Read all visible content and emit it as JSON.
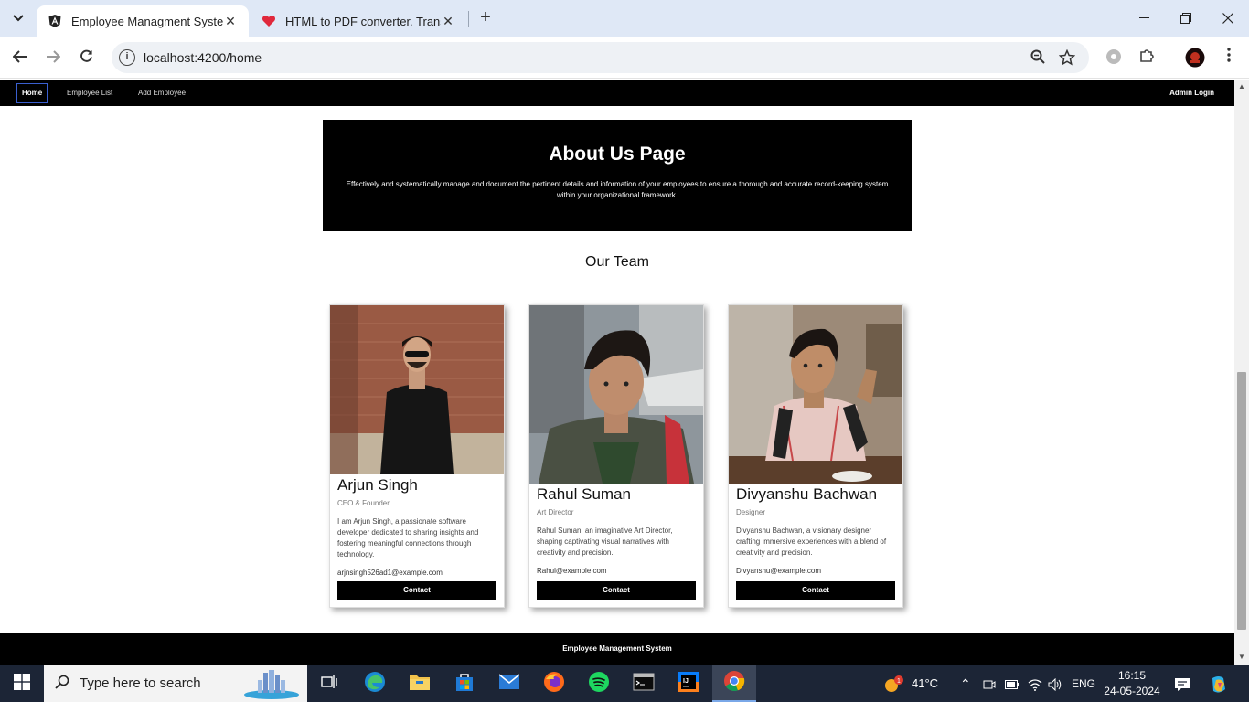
{
  "browser": {
    "tabs": [
      {
        "title": "Employee Managment System",
        "active": true
      },
      {
        "title": "HTML to PDF converter. Transfo",
        "active": false
      }
    ],
    "url": "localhost:4200/home"
  },
  "nav": {
    "home": "Home",
    "employee_list": "Employee List",
    "add_employee": "Add Employee",
    "admin_login": "Admin Login"
  },
  "about": {
    "title": "About Us Page",
    "text": "Effectively and systematically manage and document the pertinent details and information of your employees to ensure a thorough and accurate record-keeping system within your organizational framework."
  },
  "team": {
    "title": "Our Team",
    "members": [
      {
        "name": "Arjun Singh",
        "role": "CEO & Founder",
        "description": "I am Arjun Singh, a passionate software developer dedicated to sharing insights and fostering meaningful connections through technology.",
        "email": "arjnsingh526ad1@example.com",
        "button": "Contact"
      },
      {
        "name": "Rahul Suman",
        "role": "Art Director",
        "description": "Rahul Suman, an imaginative Art Director, shaping captivating visual narratives with creativity and precision.",
        "email": "Rahul@example.com",
        "button": "Contact"
      },
      {
        "name": "Divyanshu Bachwan",
        "role": "Designer",
        "description": "Divyanshu Bachwan, a visionary designer crafting immersive experiences with a blend of creativity and precision.",
        "email": "Divyanshu@example.com",
        "button": "Contact"
      }
    ]
  },
  "footer": {
    "text": "Employee Management System"
  },
  "taskbar": {
    "search_placeholder": "Type here to search",
    "weather": "41°C",
    "weather_badge": "1",
    "language": "ENG",
    "time": "16:15",
    "date": "24-05-2024"
  },
  "colors": {
    "nav_bg": "#000000",
    "accent_border": "#3a5fd0",
    "tabstrip": "#dfe8f6",
    "taskbar": "#1c2536"
  }
}
